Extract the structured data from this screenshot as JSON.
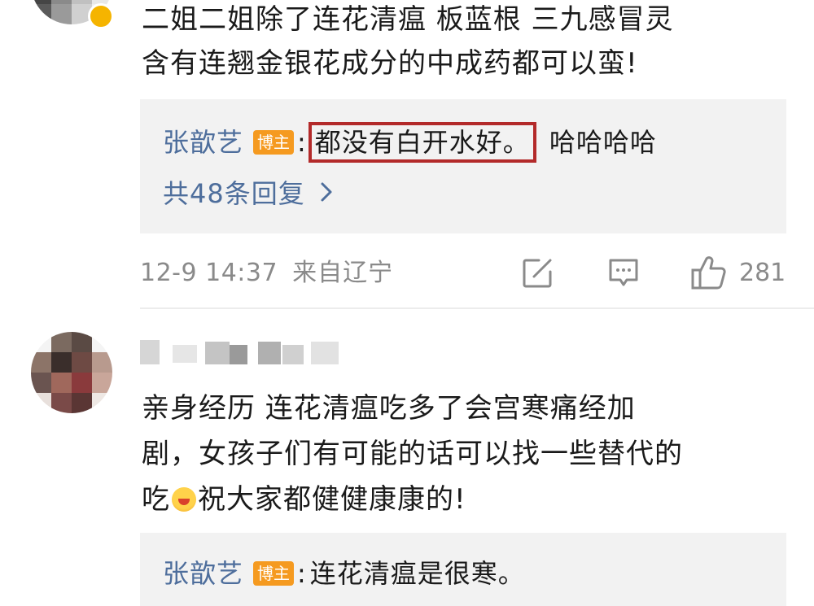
{
  "comment1": {
    "text": "二姐二姐除了连花清瘟 板蓝根 三九感冒灵\n含有连翘金银花成分的中成药都可以蛮!",
    "reply": {
      "author": "张歆艺",
      "tag": "博主",
      "colon": ":",
      "highlighted": "都没有白开水好。",
      "rest": "哈哈哈哈"
    },
    "more_replies": "共48条回复",
    "time": "12-9 14:37",
    "from": "来自辽宁",
    "likes": "281"
  },
  "comment2": {
    "text_before_emoji": "亲身经历 连花清瘟吃多了会宫寒痛经加\n剧，女孩子们有可能的话可以找一些替代的\n吃",
    "text_after_emoji": "祝大家都健健康康的!",
    "reply": {
      "author": "张歆艺",
      "tag": "博主",
      "colon": ":",
      "text": "连花清瘟是很寒。"
    }
  },
  "icons": {
    "share": "share-icon",
    "comment": "comment-icon",
    "like": "thumbs-up-icon",
    "chevron": "chevron-right-icon",
    "emoji": "tongue-out-emoji-icon"
  },
  "colors": {
    "author_link": "#4e6e9c",
    "blogger_tag": "#f59a20",
    "highlight_border": "#b32a2a",
    "reply_bg": "#f2f2f2",
    "meta_text": "#8a8a8a"
  }
}
